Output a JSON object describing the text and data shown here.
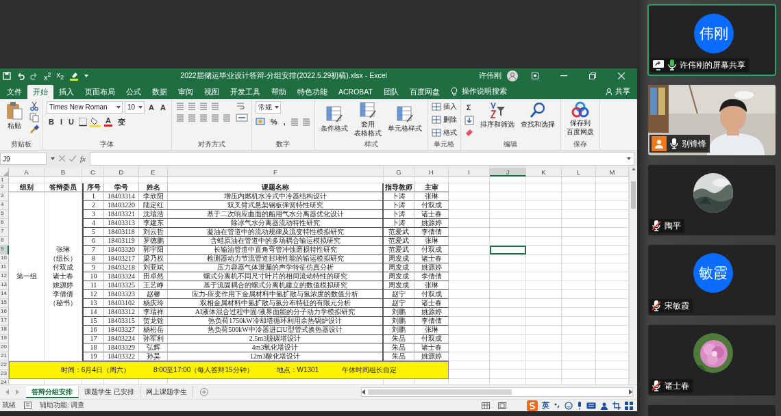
{
  "excel": {
    "quick_access": [
      {
        "kind": "save"
      },
      {
        "kind": "undo"
      },
      {
        "kind": "redo"
      },
      {
        "kind": "text",
        "text": "x$^{2}$"
      },
      {
        "kind": "text",
        "text": "x$_{2}$"
      },
      {
        "kind": "highlight"
      }
    ],
    "title": "2022届储运毕业设计答辩-分组安排(2022.5.29初稿).xlsx - Excel",
    "user": "许伟刚",
    "tabs": [
      {
        "label": "文件",
        "selected": false
      },
      {
        "label": "开始",
        "selected": true
      },
      {
        "label": "插入",
        "selected": false
      },
      {
        "label": "页面布局",
        "selected": false
      },
      {
        "label": "公式",
        "selected": false
      },
      {
        "label": "数据",
        "selected": false
      },
      {
        "label": "审阅",
        "selected": false
      },
      {
        "label": "视图",
        "selected": false
      },
      {
        "label": "开发工具",
        "selected": false
      },
      {
        "label": "帮助",
        "selected": false
      },
      {
        "label": "特色功能",
        "selected": false
      },
      {
        "label": "ACROBAT",
        "selected": false
      },
      {
        "label": "团队",
        "selected": false
      },
      {
        "label": "百度网盘",
        "selected": false
      }
    ],
    "tell_me": "操作说明搜索",
    "share": "共享",
    "ribbon": [
      {
        "label": "剪贴板",
        "blocks": [
          [
            [
              {
                "kind": "paste",
                "label": "粘贴"
              }
            ]
          ],
          [
            [
              {
                "kind": "cut"
              }
            ],
            [
              {
                "kind": "copy"
              }
            ],
            [
              {
                "kind": "brush"
              }
            ]
          ]
        ]
      },
      {
        "label": "字体",
        "blocks": [
          [
            [
              {
                "kind": "field",
                "value": "Times New Roman"
              },
              {
                "kind": "field",
                "value": "10"
              },
              {
                "kind": "glyph",
                "text": "A"
              },
              {
                "kind": "glyph",
                "text": "A"
              }
            ],
            [
              {
                "kind": "glyph",
                "text": "B"
              },
              {
                "kind": "glyph",
                "text": "I"
              },
              {
                "kind": "glyph",
                "text": "U"
              },
              {
                "kind": "border"
              },
              {
                "kind": "swatch",
                "color": "#f5e400"
              },
              {
                "kind": "color",
                "text": "A",
                "color": "#e02020"
              },
              {
                "kind": "glyph",
                "text": "变"
              }
            ]
          ]
        ]
      },
      {
        "label": "对齐方式",
        "blocks": [
          [
            [
              {
                "kind": "lines"
              },
              {
                "kind": "lines"
              },
              {
                "kind": "lines"
              },
              {
                "kind": "lines"
              }
            ],
            [
              {
                "kind": "lines"
              },
              {
                "kind": "lines"
              },
              {
                "kind": "lines"
              },
              {
                "kind": "lines"
              },
              {
                "kind": "lines"
              }
            ]
          ],
          [
            [
              {
                "kind": "wrap"
              }
            ],
            [
              {
                "kind": "merge"
              }
            ]
          ]
        ]
      },
      {
        "label": "数字",
        "blocks": [
          [
            [
              {
                "kind": "field",
                "value": "常规"
              }
            ],
            [
              {
                "kind": "currency"
              },
              {
                "kind": "glyph",
                "text": "%"
              },
              {
                "kind": "glyph",
                "text": ","
              },
              {
                "kind": "lines"
              },
              {
                "kind": "lines"
              }
            ]
          ]
        ]
      },
      {
        "label": "样式",
        "blocks": [
          [
            [
              {
                "kind": "large",
                "label": "条件格式"
              },
              {
                "kind": "large",
                "lines": [
                  "套用",
                  "表格格式"
                ]
              },
              {
                "kind": "large",
                "label": "单元格样式"
              }
            ]
          ]
        ]
      },
      {
        "label": "单元格",
        "blocks": [
          [
            [
              {
                "kind": "small",
                "label": "插入"
              }
            ],
            [
              {
                "kind": "small",
                "label": "删除"
              }
            ],
            [
              {
                "kind": "small",
                "label": "格式"
              }
            ]
          ]
        ]
      },
      {
        "label": "编辑",
        "blocks": [
          [
            [
              {
                "kind": "glyph",
                "text": "Σ"
              }
            ],
            [
              {
                "kind": "fill"
              }
            ],
            [
              {
                "kind": "eraser"
              }
            ]
          ],
          [
            [
              {
                "kind": "sort",
                "label": "排序和筛选"
              },
              {
                "kind": "find",
                "label": "查找和选择"
              }
            ]
          ]
        ]
      },
      {
        "label": "保存",
        "blocks": [
          [
            [
              {
                "kind": "cloud",
                "lines": [
                  "保存到",
                  "百度网盘"
                ]
              }
            ]
          ]
        ]
      }
    ],
    "name_box": "J9",
    "formula_label": "fx",
    "sheet": {
      "columns": [
        {
          "label": "A",
          "selected": false
        },
        {
          "label": "B",
          "selected": false
        },
        {
          "label": "C",
          "selected": false
        },
        {
          "label": "D",
          "selected": false
        },
        {
          "label": "E",
          "selected": false
        },
        {
          "label": "F",
          "selected": false
        },
        {
          "label": "G",
          "selected": false
        },
        {
          "label": "H",
          "selected": false
        },
        {
          "label": "I",
          "selected": false
        },
        {
          "label": "J",
          "selected": true
        },
        {
          "label": "K",
          "selected": false
        },
        {
          "label": "L",
          "selected": false
        },
        {
          "label": "M",
          "selected": false
        }
      ],
      "rows": [
        {
          "label": "1",
          "selected": false
        },
        {
          "label": "2",
          "selected": false
        },
        {
          "label": "3",
          "selected": false
        },
        {
          "label": "4",
          "selected": false
        },
        {
          "label": "5",
          "selected": false
        },
        {
          "label": "6",
          "selected": false
        },
        {
          "label": "7",
          "selected": false
        },
        {
          "label": "8",
          "selected": false
        },
        {
          "label": "9",
          "selected": true
        },
        {
          "label": "10",
          "selected": false
        },
        {
          "label": "11",
          "selected": false
        },
        {
          "label": "12",
          "selected": false
        },
        {
          "label": "13",
          "selected": false
        },
        {
          "label": "14",
          "selected": false
        },
        {
          "label": "15",
          "selected": false
        },
        {
          "label": "16",
          "selected": false
        },
        {
          "label": "17",
          "selected": false
        },
        {
          "label": "18",
          "selected": false
        },
        {
          "label": "19",
          "selected": false
        },
        {
          "label": "20",
          "selected": false
        },
        {
          "label": "21",
          "selected": false
        },
        {
          "label": "22",
          "selected": false
        },
        {
          "label": "23",
          "selected": false
        },
        {
          "label": "24",
          "selected": false
        }
      ],
      "headers": [
        "组别",
        "答辩委员",
        "序号",
        "学号",
        "姓名",
        "课题名称",
        "指导教师",
        "主审"
      ],
      "group": "第一组",
      "committee": [
        "张琳",
        "（组长）",
        "付双成",
        "诸士春",
        "姚源婷",
        "李倩倩",
        "（秘书）"
      ],
      "records": [
        [
          "1",
          "18403314",
          "李欣阳",
          "增压内燃机水冷式中冷器结构设计",
          "卜涛",
          "张琳"
        ],
        [
          "2",
          "18403220",
          "陆定红",
          "双叉臂式悬架钢板弹簧特性研究",
          "卜涛",
          "付双成"
        ],
        [
          "3",
          "18403321",
          "沈瑞浩",
          "基于二次响应曲面的船用气水分离器优化设计",
          "卜涛",
          "诸士春"
        ],
        [
          "4",
          "18403313",
          "李建东",
          "除冰气水分离器流动特性研究",
          "卜涛",
          "姚源婷"
        ],
        [
          "5",
          "18403118",
          "刘云哲",
          "凝油在管道中的流动规律及流变特性模拟研究",
          "范爱武",
          "李倩倩"
        ],
        [
          "6",
          "18403119",
          "罗德鹏",
          "含蜡原油在管道中的多场耦合输运模拟研究",
          "范爱武",
          "张琳"
        ],
        [
          "7",
          "18403320",
          "郭宇阳",
          "长输油管道中直角弯管冲蚀磨损特性研究",
          "范爱武",
          "付双成"
        ],
        [
          "8",
          "18403217",
          "梁乃权",
          "检测器动力节流管道封堵性能的输运模拟研究",
          "周发成",
          "诸士春"
        ],
        [
          "9",
          "18403218",
          "刘亚斌",
          "压力容器气体泄漏的声学特征仿真分析",
          "周发成",
          "姚源婷"
        ],
        [
          "10",
          "18403324",
          "田卓然",
          "螺式分离机不同尺寸叶片的相间流动特性的研究",
          "周发成",
          "李倩倩"
        ],
        [
          "11",
          "18403325",
          "王艺峥",
          "基于流固耦合的螺式分离机建立的数值模拟研究",
          "周发成",
          "张琳"
        ],
        [
          "12",
          "18403323",
          "赵馨",
          "应力-应变作用下金属材料中氢扩散与氢浓度的数值分析",
          "赵宁",
          "付双成"
        ],
        [
          "13",
          "18403102",
          "杨庆玲",
          "双相金属材料中氢扩散与氢分布特征的有限元分析",
          "赵宁",
          "诸士春"
        ],
        [
          "14",
          "18403312",
          "李瑞祥",
          "AI液体混合过程中固/液界面能的分子动力学模拟研究",
          "刘鹏",
          "姚源婷"
        ],
        [
          "15",
          "18403315",
          "贺龙铨",
          "热负荷1750kW冷却塔循环利用余热锅炉设计",
          "刘鹏",
          "李倩倩"
        ],
        [
          "16",
          "18403327",
          "杨松岳",
          "热负荷500kW中冷器进口U型管式换热器设计",
          "刘鹏",
          "张琳"
        ],
        [
          "17",
          "18403224",
          "孙军利",
          "2.5m3脱碳塔设计",
          "朱品",
          "付双成"
        ],
        [
          "18",
          "18403329",
          "弘辉",
          "4m3氧化塔设计",
          "朱品",
          "诸士春"
        ],
        [
          "19",
          "18403322",
          "孙昊",
          "12m3酸化塔设计",
          "朱品",
          "姚源婷"
        ]
      ],
      "notice": [
        "时间：6月4日（周六）",
        "8:00至17:00（每人答辩15分钟）",
        "地点：W1301",
        "午休时间组长自定"
      ]
    },
    "sheet_tabs": [
      {
        "label": "答辩分组安排",
        "selected": true
      },
      {
        "label": "课题学生 已安排",
        "selected": false
      },
      {
        "label": "网上课题学生",
        "selected": false
      }
    ],
    "status": "就绪",
    "accessibility": "辅助功能: 调查",
    "ime": "英"
  },
  "participants": [
    {
      "kind": "initials",
      "initials": "伟刚",
      "name": "许伟刚的屏幕共享",
      "sharing": true,
      "host": false,
      "muted": false,
      "speaking": true,
      "active": true
    },
    {
      "kind": "video",
      "name": "别锋锋",
      "sharing": false,
      "host": true,
      "muted": false,
      "speaking": false,
      "active": false
    },
    {
      "name": "陶平",
      "sharing": false,
      "host": false,
      "muted": true,
      "active": false
    },
    {
      "kind": "initials",
      "initials": "敏霞",
      "name": "宋敏霞",
      "sharing": false,
      "host": false,
      "muted": true,
      "active": false
    },
    {
      "name": "诸士春",
      "sharing": false,
      "host": false,
      "muted": true,
      "active": false
    }
  ]
}
